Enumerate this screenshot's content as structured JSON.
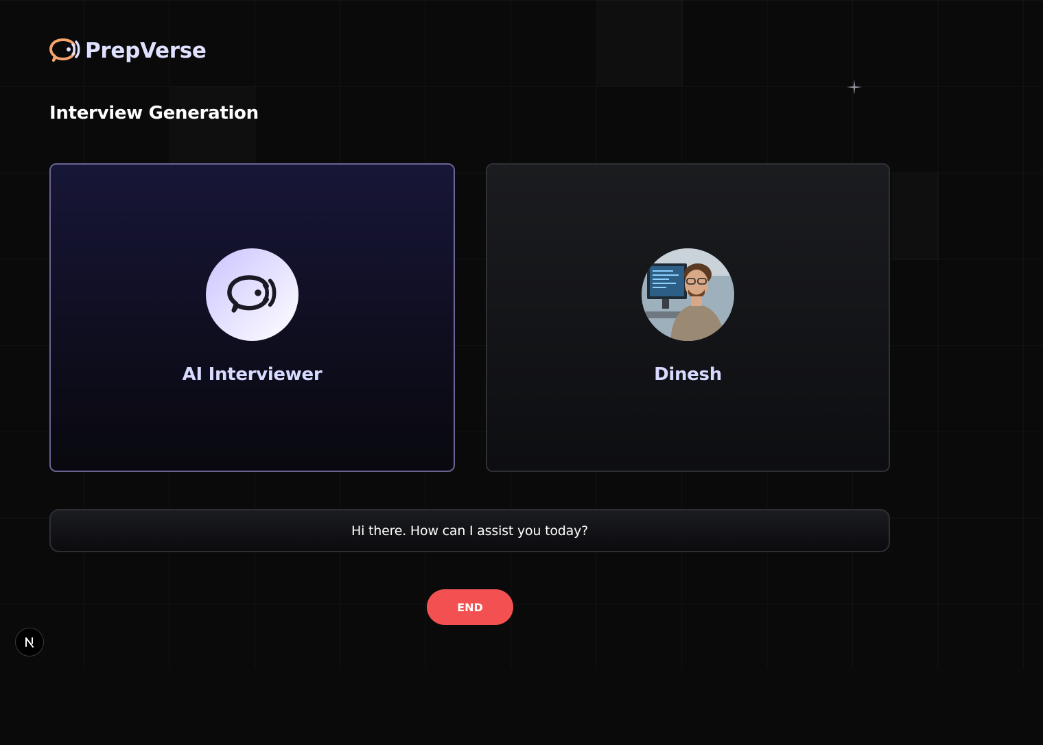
{
  "brand": {
    "name": "PrepVerse",
    "icon": "chat-voice-icon",
    "colors": {
      "icon_orange": "#f5a46e",
      "icon_lavender": "#dfe1ff"
    }
  },
  "page": {
    "title": "Interview Generation"
  },
  "participants": {
    "ai": {
      "name": "AI Interviewer",
      "icon": "chat-voice-icon",
      "active": true
    },
    "user": {
      "name": "Dinesh",
      "avatar": "user-photo"
    }
  },
  "transcript": {
    "message": "Hi there. How can I assist you today?"
  },
  "controls": {
    "end_label": "END",
    "end_color": "#f35151"
  },
  "dev_indicator": {
    "icon": "nextjs-icon"
  }
}
